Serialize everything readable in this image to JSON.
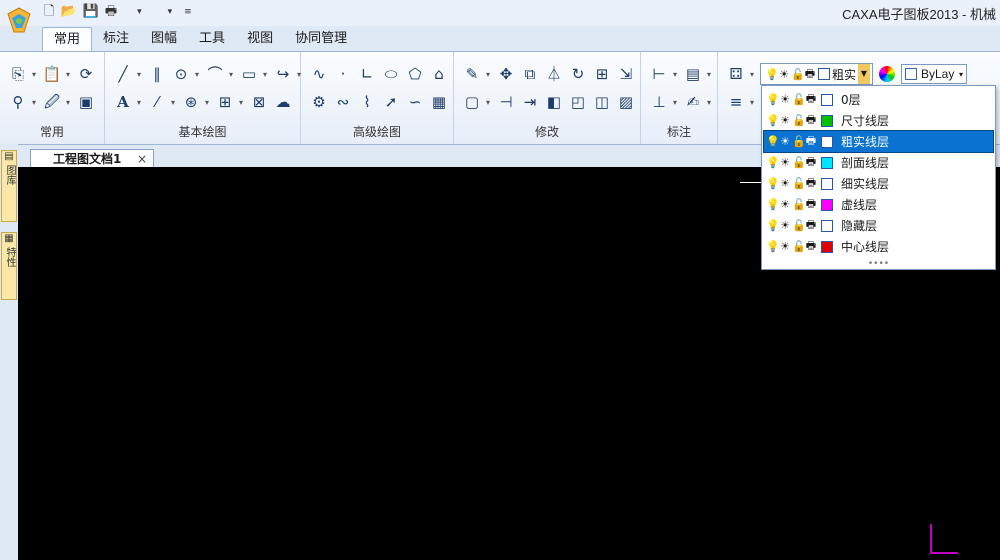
{
  "window": {
    "title": "CAXA电子图板2013 - 机械"
  },
  "qat": {
    "icons": [
      "new-file-icon",
      "open-folder-icon",
      "save-icon",
      "print-icon"
    ]
  },
  "tabs": [
    {
      "label": "常用",
      "active": true
    },
    {
      "label": "标注",
      "active": false
    },
    {
      "label": "图幅",
      "active": false
    },
    {
      "label": "工具",
      "active": false
    },
    {
      "label": "视图",
      "active": false
    },
    {
      "label": "协同管理",
      "active": false
    }
  ],
  "ribbon": {
    "groups": [
      {
        "label": "常用"
      },
      {
        "label": "基本绘图"
      },
      {
        "label": "高级绘图"
      },
      {
        "label": "修改"
      },
      {
        "label": "标注"
      }
    ]
  },
  "leftStrip": {
    "btn1": "图库",
    "btn2": "特性"
  },
  "document": {
    "tab_label": "工程图文档1",
    "close_glyph": "×"
  },
  "layerCombo": {
    "current": "粗实线层",
    "bylayer": "ByLay"
  },
  "layers": [
    {
      "name": "0层",
      "color": "#ffffff",
      "selected": false
    },
    {
      "name": "尺寸线层",
      "color": "#00c000",
      "selected": false
    },
    {
      "name": "粗实线层",
      "color": "#ffffff",
      "selected": true
    },
    {
      "name": "剖面线层",
      "color": "#00e5ff",
      "selected": false
    },
    {
      "name": "细实线层",
      "color": "#ffffff",
      "selected": false
    },
    {
      "name": "虚线层",
      "color": "#ff00ff",
      "selected": false
    },
    {
      "name": "隐藏层",
      "color": "#ffffff",
      "selected": false
    },
    {
      "name": "中心线层",
      "color": "#e00000",
      "selected": false
    }
  ],
  "colors": {
    "canvas": "#000000",
    "selection": "#0a72d0",
    "axis": "#c000c0"
  }
}
